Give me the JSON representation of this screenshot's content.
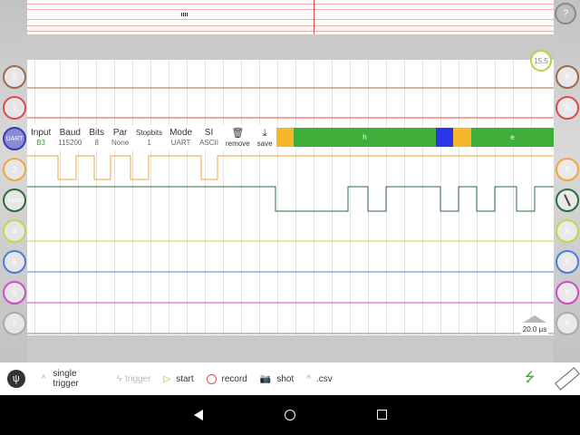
{
  "help_label": "?",
  "timebase_top": "15.5",
  "timescale": "20.0 µs",
  "decoder": {
    "name": "UART",
    "fields": [
      {
        "label": "Input",
        "value": "B3"
      },
      {
        "label": "Baud",
        "value": "115200"
      },
      {
        "label": "Bits",
        "value": "8"
      },
      {
        "label": "Par",
        "value": "None"
      },
      {
        "label": "Stopbits",
        "value": "1"
      },
      {
        "label": "Mode",
        "value": "UART"
      },
      {
        "label": "SI",
        "value": "ASCII"
      }
    ],
    "remove_label": "remove",
    "save_label": "save",
    "bytes": [
      "h",
      "e"
    ]
  },
  "channels": [
    {
      "label": "0",
      "color": "#9c6b4a"
    },
    {
      "label": "1",
      "color": "#e04a4a"
    },
    {
      "label": "UART",
      "color": "#3b3bb0"
    },
    {
      "label": "2",
      "color": "#f0a63a"
    },
    {
      "label": "input",
      "color": "#2e6b3a"
    },
    {
      "label": "4",
      "color": "#c9d24a"
    },
    {
      "label": "5",
      "color": "#4a7ce0"
    },
    {
      "label": "6",
      "color": "#d04ac8"
    },
    {
      "label": "7",
      "color": "#8a8a8a"
    }
  ],
  "x_label": "X",
  "toolbar": {
    "single_trigger": "single trigger",
    "trigger": "trigger",
    "start": "start",
    "record": "record",
    "shot": "shot",
    "csv": ".csv"
  }
}
